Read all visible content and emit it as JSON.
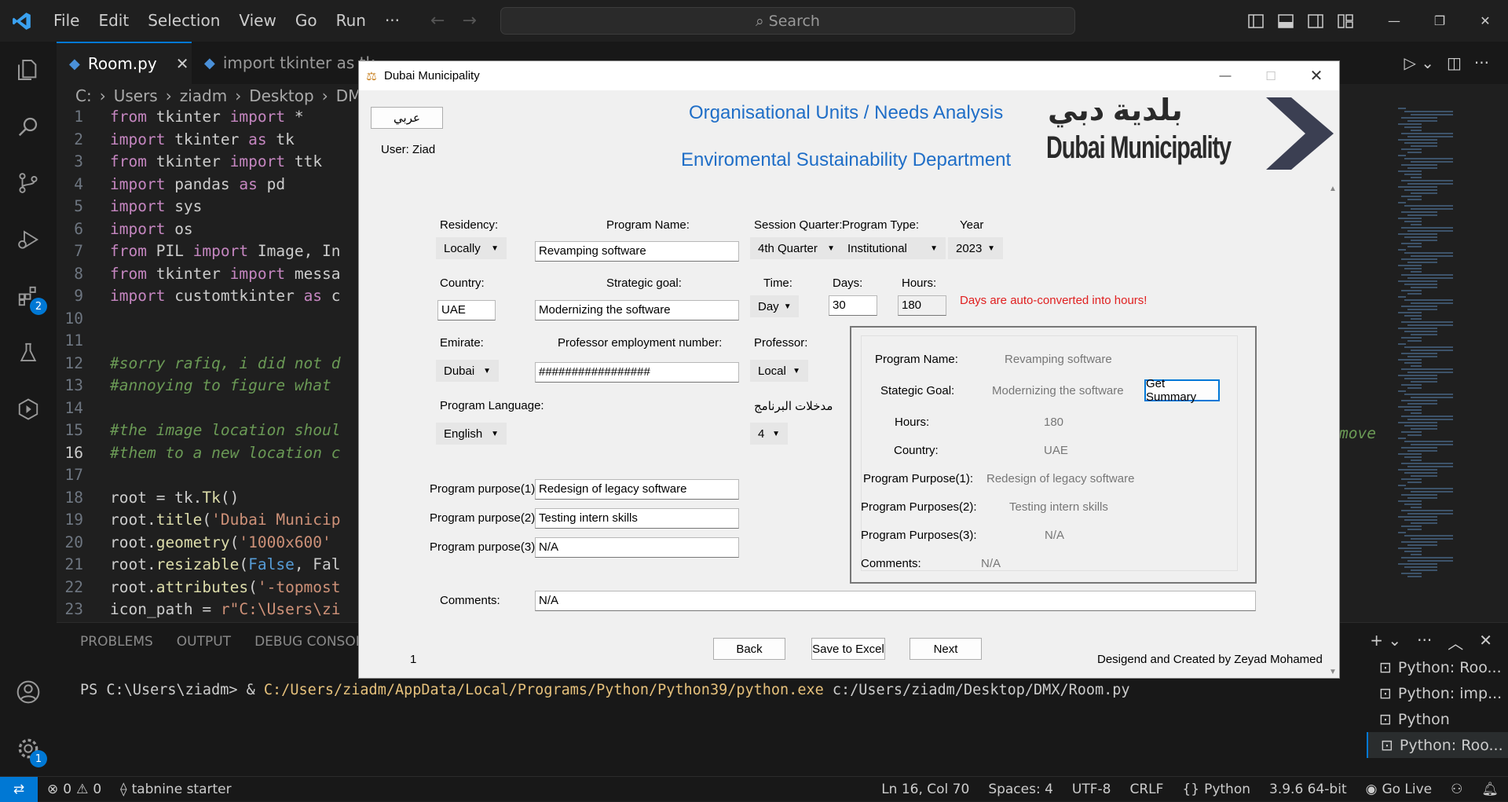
{
  "vscode": {
    "menu": [
      "File",
      "Edit",
      "Selection",
      "View",
      "Go",
      "Run",
      "···"
    ],
    "search_placeholder": "Search",
    "tabs": [
      {
        "label": "Room.py",
        "active": true
      },
      {
        "label": "import tkinter as tk",
        "active": false
      }
    ],
    "breadcrumb": [
      "C:",
      "Users",
      "ziadm",
      "Desktop",
      "DMX"
    ],
    "code_lines": [
      {
        "n": "1",
        "t": "from tkinter import *"
      },
      {
        "n": "2",
        "t": "import tkinter as tk"
      },
      {
        "n": "3",
        "t": "from tkinter import ttk"
      },
      {
        "n": "4",
        "t": "import pandas as pd"
      },
      {
        "n": "5",
        "t": "import sys"
      },
      {
        "n": "6",
        "t": "import os"
      },
      {
        "n": "7",
        "t": "from PIL import Image, In"
      },
      {
        "n": "8",
        "t": "from tkinter import messa"
      },
      {
        "n": "9",
        "t": "import customtkinter as c"
      },
      {
        "n": "10",
        "t": ""
      },
      {
        "n": "11",
        "t": ""
      },
      {
        "n": "12",
        "t": "#sorry rafiq, i did not d"
      },
      {
        "n": "13",
        "t": "#annoying to figure what"
      },
      {
        "n": "14",
        "t": ""
      },
      {
        "n": "15",
        "t": "#the image location shoul"
      },
      {
        "n": "16",
        "t": "#them to a new location c"
      },
      {
        "n": "17",
        "t": ""
      },
      {
        "n": "18",
        "t": "root = tk.Tk()"
      },
      {
        "n": "19",
        "t": "root.title('Dubai Municip"
      },
      {
        "n": "20",
        "t": "root.geometry('1000x600'"
      },
      {
        "n": "21",
        "t": "root.resizable(False, Fal"
      },
      {
        "n": "22",
        "t": "root.attributes('-topmost"
      },
      {
        "n": "23",
        "t": "icon_path = r\"C:\\Users\\zi"
      }
    ],
    "code_overflow_right": "move",
    "panel_tabs": [
      "PROBLEMS",
      "OUTPUT",
      "DEBUG CONSOLE"
    ],
    "terminal_prompt": "PS C:\\Users\\ziadm> & ",
    "terminal_exe": "C:/Users/ziadm/AppData/Local/Programs/Python/Python39/python.exe",
    "terminal_arg": " c:/Users/ziadm/Desktop/DMX/Room.py",
    "terminal_list": [
      "Python: Roo...",
      "Python: imp...",
      "Python",
      "Python: Roo..."
    ],
    "status": {
      "errors": "0",
      "warnings": "0",
      "tabnine": "tabnine starter",
      "position": "Ln 16, Col 70",
      "spaces": "Spaces: 4",
      "encoding": "UTF-8",
      "eol": "CRLF",
      "language": "Python",
      "version": "3.9.6 64-bit",
      "golive": "Go Live"
    },
    "badges": {
      "extensions": "2",
      "accounts": "1"
    }
  },
  "tk": {
    "window_title": "Dubai Municipality",
    "arabic_button": "عربي",
    "user": "User: Ziad",
    "header1": "Organisational Units / Needs Analysis",
    "header2": "Enviromental Sustainability Department",
    "logo_ar": "بلدية دبي",
    "logo_en": "Dubai Municipality",
    "labels": {
      "residency": "Residency:",
      "program_name": "Program Name:",
      "session_quarter": "Session Quarter:",
      "program_type": "Program Type:",
      "year": "Year",
      "country": "Country:",
      "strategic_goal": "Strategic goal:",
      "time": "Time:",
      "days": "Days:",
      "hours": "Hours:",
      "emirate": "Emirate:",
      "prof_emp_no": "Professor employment number:",
      "professor": "Professor:",
      "program_language": "Program Language:",
      "program_inputs_ar": "مدخلات البرنامج",
      "purpose1": "Program purpose(1)",
      "purpose2": "Program purpose(2)",
      "purpose3": "Program purpose(3)",
      "comments": "Comments:"
    },
    "values": {
      "residency": "Locally",
      "program_name": "Revamping software",
      "session_quarter": "4th Quarter",
      "program_type": "Institutional",
      "year": "2023",
      "country": "UAE",
      "strategic_goal": "Modernizing the software",
      "time": "Day",
      "days": "30",
      "hours": "180",
      "emirate": "Dubai",
      "prof_emp_no": "#################",
      "professor": "Local",
      "program_language": "English",
      "program_inputs": "4",
      "purpose1": "Redesign of legacy software",
      "purpose2": "Testing intern skills",
      "purpose3": "N/A",
      "comments": "N/A"
    },
    "warning": "Days are auto-converted into hours!",
    "summary": {
      "program_name_lbl": "Program Name:",
      "program_name": "Revamping software",
      "goal_lbl": "Stategic Goal:",
      "goal": "Modernizing the software",
      "get_summary": "Get Summary",
      "hours_lbl": "Hours:",
      "hours": "180",
      "country_lbl": "Country:",
      "country": "UAE",
      "p1_lbl": "Program Purpose(1):",
      "p1": "Redesign of legacy software",
      "p2_lbl": "Program Purposes(2):",
      "p2": "Testing intern skills",
      "p3_lbl": "Program Purposes(3):",
      "p3": "N/A",
      "comments_lbl": "Comments:",
      "comments": "N/A"
    },
    "buttons": {
      "back": "Back",
      "save": "Save to Excel",
      "next": "Next"
    },
    "page_number": "1",
    "credit": "Desigend and Created by Zeyad Mohamed"
  }
}
